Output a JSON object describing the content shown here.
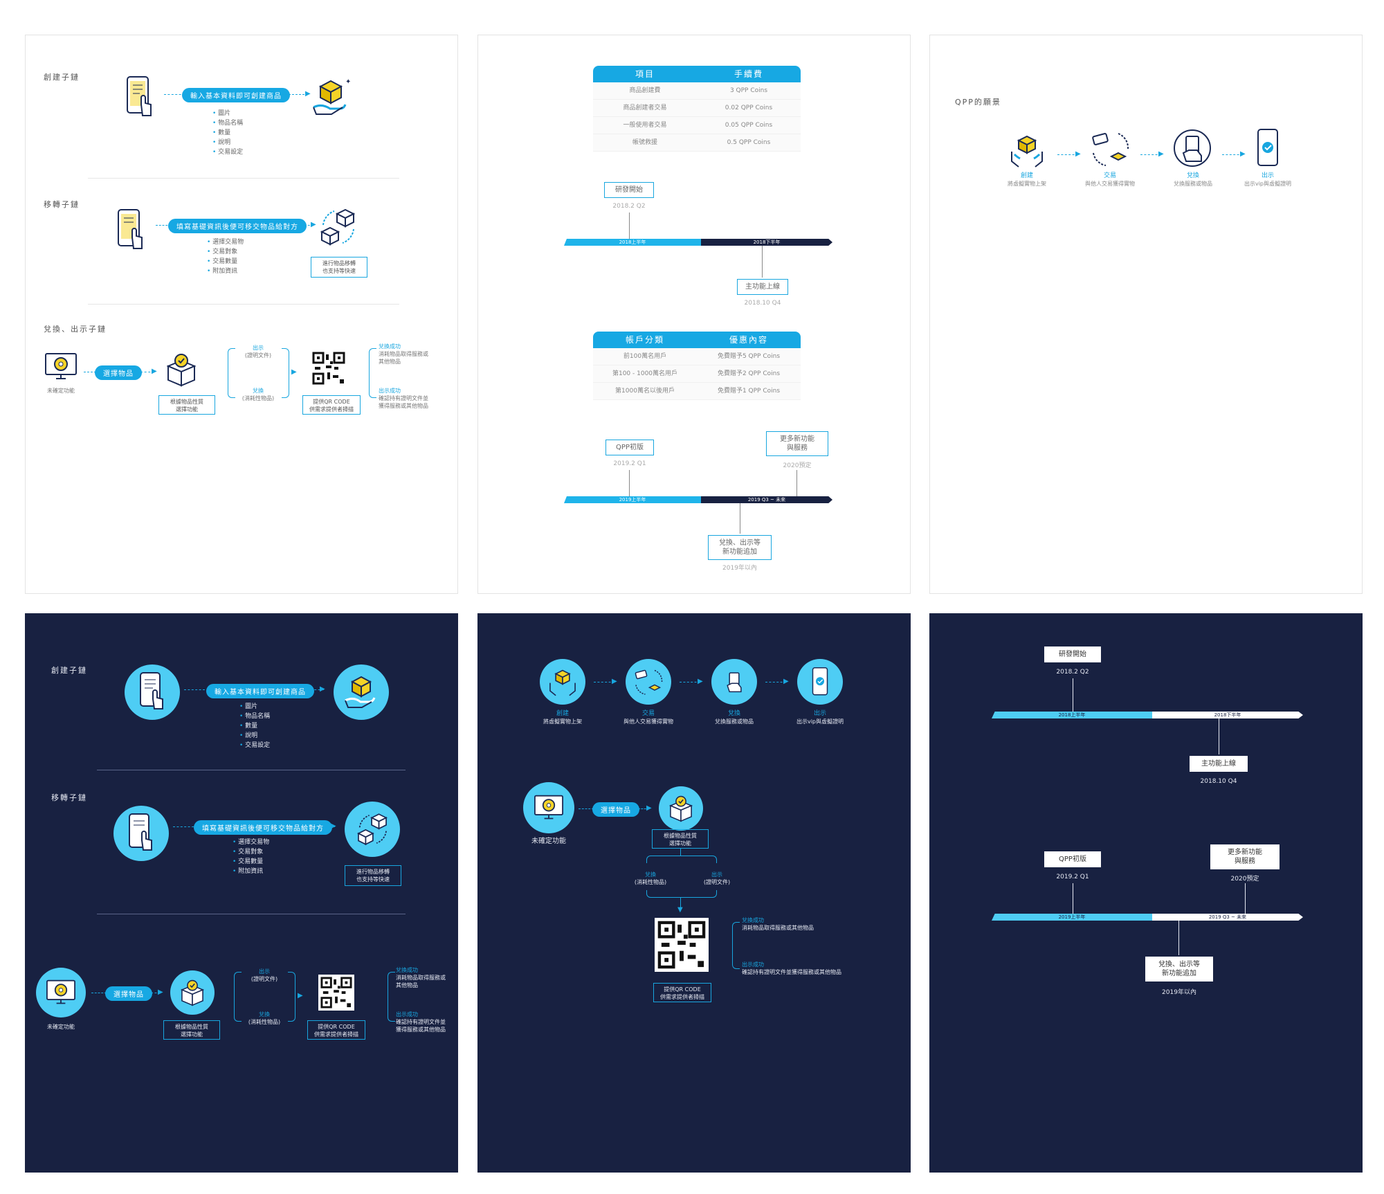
{
  "p1": {
    "sec1_title": "創建子鏈",
    "sec1_pill": "輸入基本資料即可創建商品",
    "sec1_bullets": [
      "圖片",
      "物品名稱",
      "數量",
      "說明",
      "交易設定"
    ],
    "sec2_title": "移轉子鏈",
    "sec2_pill": "填寫基礎資訊後便可移交物品給對方",
    "sec2_bullets": [
      "選擇交易物",
      "交易對象",
      "交易數量",
      "附加資訊"
    ],
    "sec2_box": "進行物品移轉\n也支持等快速",
    "sec3_title": "兌換、出示子鏈",
    "sec3_icon_label": "未確定功能",
    "sec3_pill": "選擇物品",
    "sec3_box1": "根據物品性質\n選擇功能",
    "sec3_show": "出示",
    "sec3_show_sub": "(證明文件)",
    "sec3_redeem": "兌換",
    "sec3_redeem_sub": "(消耗性物品)",
    "sec3_box2": "提供QR CODE\n供需求提供者掃描",
    "sec3_res1_t": "兌換成功",
    "sec3_res1_d": "消耗物品取得服務或\n其他物品",
    "sec3_res2_t": "出示成功",
    "sec3_res2_d": "確認持有證明文件並\n獲得服務或其他物品"
  },
  "p2": {
    "fee_head": [
      "項目",
      "手續費"
    ],
    "fee_rows": [
      [
        "商品創建費",
        "3 QPP Coins"
      ],
      [
        "商品創建者交易",
        "0.02 QPP Coins"
      ],
      [
        "一般使用者交易",
        "0.05 QPP Coins"
      ],
      [
        "帳號救援",
        "0.5 QPP Coins"
      ]
    ],
    "tl1_top_box": "研發開始",
    "tl1_top_date": "2018.2 Q2",
    "tl1_seg1": "2018上半年",
    "tl1_seg2": "2018下半年",
    "tl1_bot_box": "主功能上線",
    "tl1_bot_date": "2018.10 Q4",
    "acc_head": [
      "帳戶分類",
      "優惠內容"
    ],
    "acc_rows": [
      [
        "前100萬名用戶",
        "免費贈予5 QPP Coins"
      ],
      [
        "第100 - 1000萬名用戶",
        "免費贈予2 QPP Coins"
      ],
      [
        "第1000萬名以後用戶",
        "免費贈予1 QPP Coins"
      ]
    ],
    "tl2_box1": "QPP初版",
    "tl2_date1": "2019.2 Q1",
    "tl2_box2": "更多新功能\n與服務",
    "tl2_date2": "2020預定",
    "tl2_seg1": "2019上半年",
    "tl2_seg2": "2019 Q3 ~ 未來",
    "tl2_bot_box": "兌換、出示等\n新功能追加",
    "tl2_bot_date": "2019年以內"
  },
  "p3": {
    "title": "QPP的願景",
    "steps": [
      {
        "a": "創建",
        "b": "將虛擬實物上架"
      },
      {
        "a": "交易",
        "b": "與他人交易獲得實物"
      },
      {
        "a": "兌換",
        "b": "兌換服務或物品"
      },
      {
        "a": "出示",
        "b": "出示vip與虛擬證明"
      }
    ]
  },
  "p5": {
    "steps": [
      {
        "a": "創建",
        "b": "將虛擬實物上架"
      },
      {
        "a": "交易",
        "b": "與他人交易獲得實物"
      },
      {
        "a": "兌換",
        "b": "兌換服務或物品"
      },
      {
        "a": "出示",
        "b": "出示vip與虛擬證明"
      }
    ],
    "icon_label": "未確定功能",
    "pill": "選擇物品",
    "box1": "根據物品性質\n選擇功能",
    "redeem": "兌換",
    "redeem_sub": "(消耗性物品)",
    "show": "出示",
    "show_sub": "(證明文件)",
    "box2": "提供QR CODE\n供需求提供者掃描",
    "res1_t": "兌換成功",
    "res1_d": "消耗物品取得服務或其他物品",
    "res2_t": "出示成功",
    "res2_d": "確認持有證明文件並獲得服務或其他物品"
  },
  "colors": {
    "accent": "#18a6df",
    "navy": "#182141",
    "yellow": "#f5d327"
  }
}
